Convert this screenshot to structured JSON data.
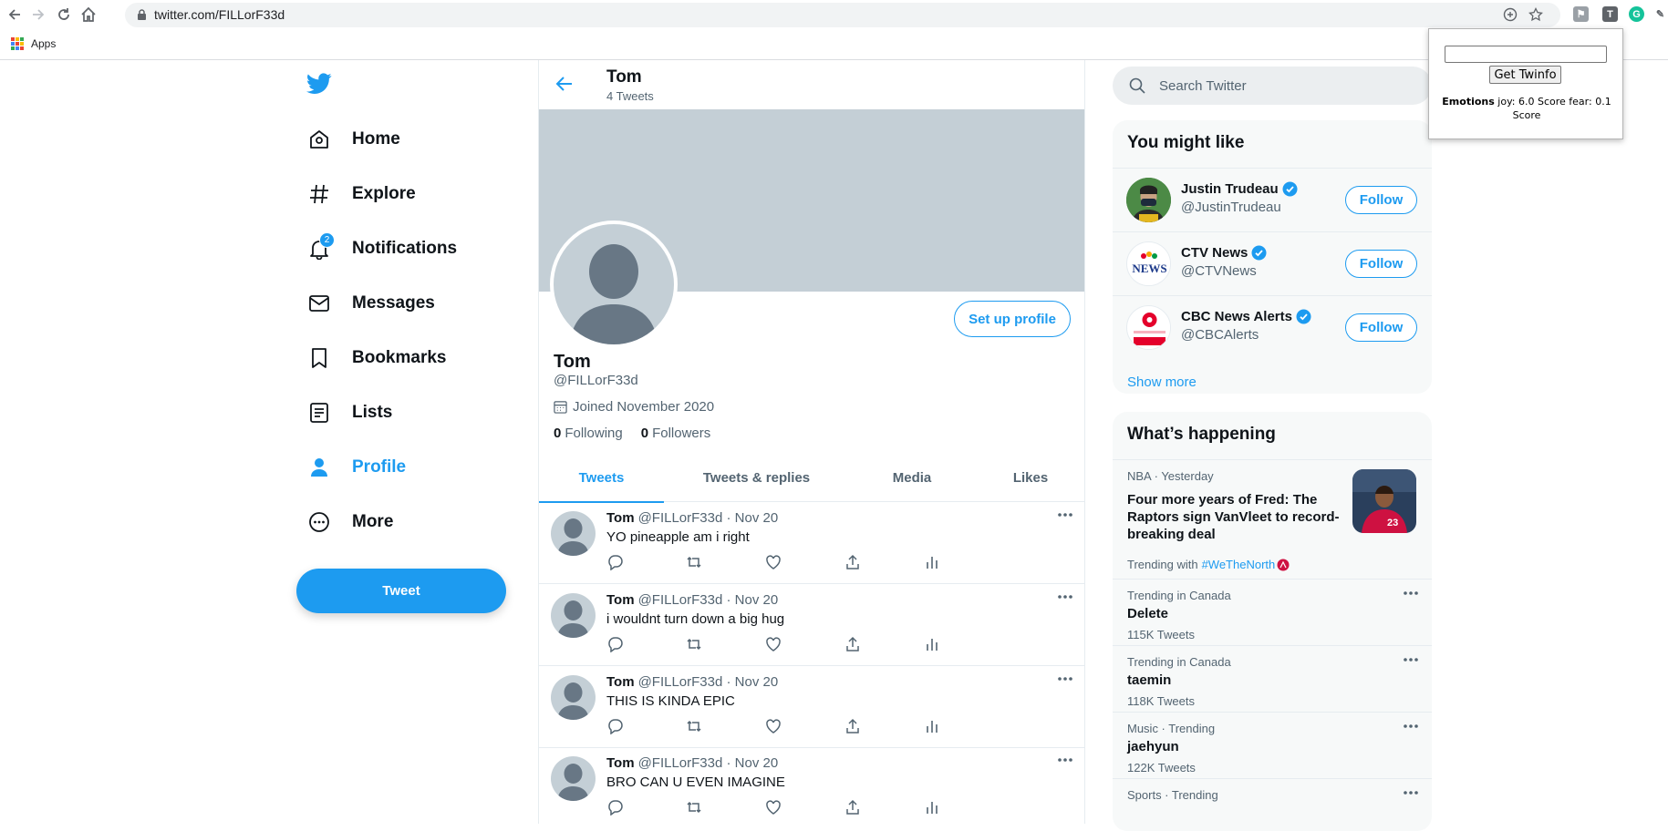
{
  "browser": {
    "url": "twitter.com/FILLorF33d",
    "bookmarks_apps": "Apps"
  },
  "nav": {
    "items": [
      {
        "label": "Home",
        "icon": "home-icon"
      },
      {
        "label": "Explore",
        "icon": "hashtag-icon"
      },
      {
        "label": "Notifications",
        "icon": "bell-icon",
        "badge": "2"
      },
      {
        "label": "Messages",
        "icon": "envelope-icon"
      },
      {
        "label": "Bookmarks",
        "icon": "bookmark-icon"
      },
      {
        "label": "Lists",
        "icon": "list-icon"
      },
      {
        "label": "Profile",
        "icon": "person-icon",
        "active": true
      },
      {
        "label": "More",
        "icon": "more-circle-icon"
      }
    ],
    "tweet_button": "Tweet"
  },
  "header": {
    "title": "Tom",
    "subtitle": "4 Tweets"
  },
  "profile": {
    "name": "Tom",
    "handle": "@FILLorF33d",
    "joined": "Joined November 2020",
    "following_count": "0",
    "following_label": "Following",
    "followers_count": "0",
    "followers_label": "Followers",
    "setup_button": "Set up profile"
  },
  "tabs": [
    "Tweets",
    "Tweets & replies",
    "Media",
    "Likes"
  ],
  "tweets": [
    {
      "name": "Tom",
      "handle": "@FILLorF33d · Nov 20",
      "text": "YO pineapple am i right"
    },
    {
      "name": "Tom",
      "handle": "@FILLorF33d · Nov 20",
      "text": "i wouldnt turn down a big hug"
    },
    {
      "name": "Tom",
      "handle": "@FILLorF33d · Nov 20",
      "text": "THIS IS KINDA EPIC"
    },
    {
      "name": "Tom",
      "handle": "@FILLorF33d · Nov 20",
      "text": "BRO CAN U EVEN IMAGINE"
    }
  ],
  "search": {
    "placeholder": "Search Twitter"
  },
  "you_might_like": {
    "title": "You might like",
    "accounts": [
      {
        "name": "Justin Trudeau",
        "handle": "@JustinTrudeau",
        "button": "Follow"
      },
      {
        "name": "CTV News",
        "handle": "@CTVNews",
        "button": "Follow"
      },
      {
        "name": "CBC News Alerts",
        "handle": "@CBCAlerts",
        "button": "Follow"
      }
    ],
    "show_more": "Show more"
  },
  "whats_happening": {
    "title": "What’s happening",
    "news": {
      "context": "NBA · Yesterday",
      "title": "Four more years of Fred: The Raptors sign VanVleet to record-breaking deal",
      "with_label": "Trending with",
      "hashtag": "#WeTheNorth"
    },
    "trends": [
      {
        "context": "Trending in Canada",
        "title": "Delete",
        "count": "115K Tweets"
      },
      {
        "context": "Trending in Canada",
        "title": "taemin",
        "count": "118K Tweets"
      },
      {
        "context": "Music · Trending",
        "title": "jaehyun",
        "count": "122K Tweets"
      },
      {
        "context": "Sports · Trending",
        "title": "",
        "count": ""
      }
    ]
  },
  "extension_popup": {
    "button": "Get Twinfo",
    "result_label": "Emotions",
    "result_text": " joy: 6.0 Score fear: 0.1 Score"
  },
  "colors": {
    "accent": "#1d9bf0",
    "banner": "#c4cfd6",
    "muted_text": "#536471"
  }
}
